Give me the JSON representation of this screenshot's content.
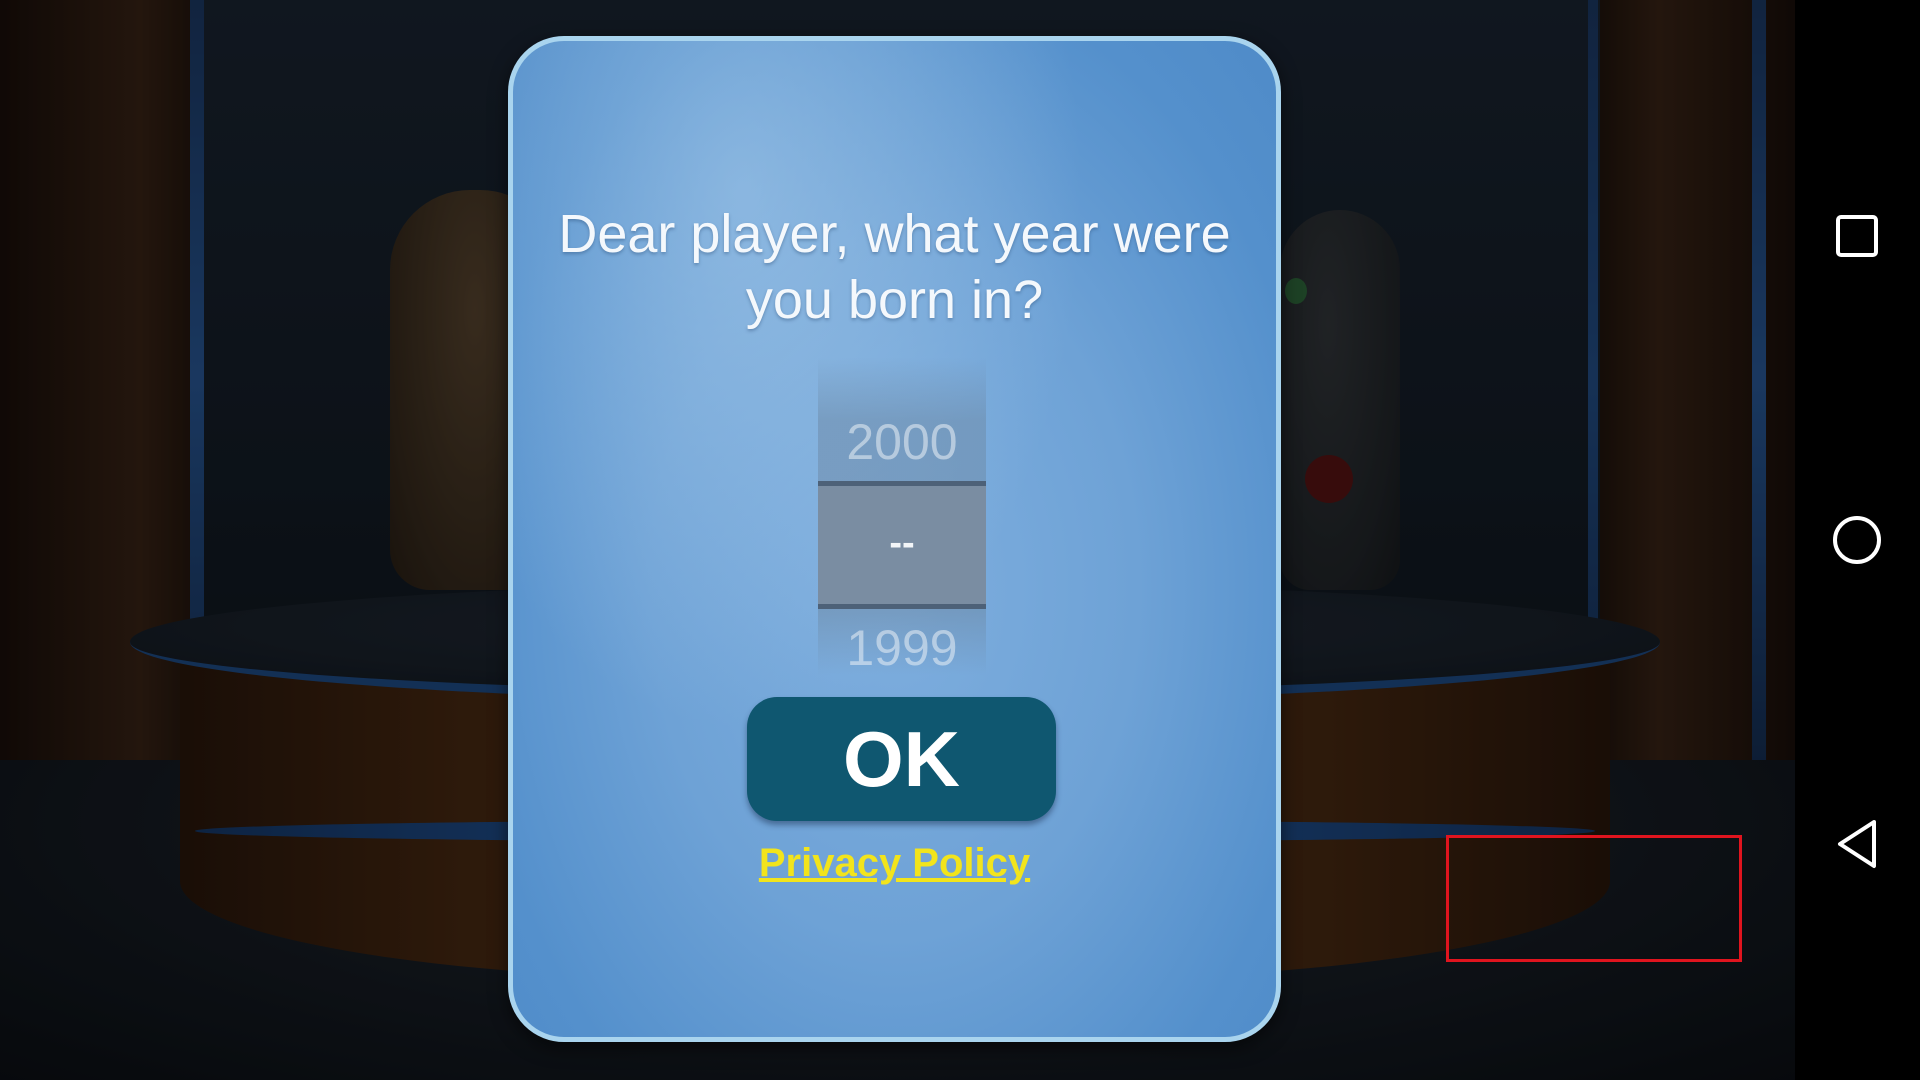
{
  "dialog": {
    "question": "Dear player, what year were you born in?",
    "year_picker": {
      "above": "2000",
      "selected": "--",
      "below": "1999"
    },
    "ok_label": "OK",
    "privacy_label": "Privacy Policy"
  },
  "navbar": {
    "icons": [
      "recent-apps-icon",
      "home-icon",
      "back-icon"
    ]
  },
  "colors": {
    "dialog_bg": "#6ea2d6",
    "dialog_border": "#a9d4ee",
    "ok_button": "#0f5770",
    "privacy_link": "#f2e41c",
    "highlight_box": "#e0141e"
  }
}
